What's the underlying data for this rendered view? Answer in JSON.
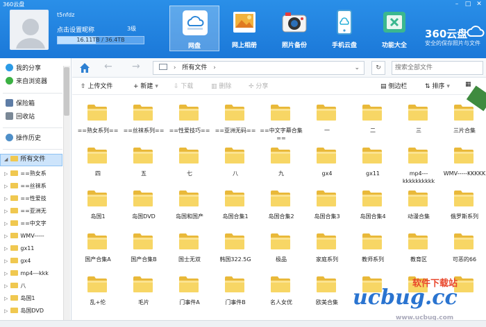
{
  "window": {
    "title": "360云盘"
  },
  "user": {
    "name": "t5nfdz",
    "nick_prompt": "点击设置昵称",
    "level": "3级",
    "quota_text": "16.11TB / 36.4TB",
    "quota_fraction": 0.443
  },
  "nav": [
    {
      "label": "网盘",
      "icon": "cloud-drive-icon"
    },
    {
      "label": "网上相册",
      "icon": "photo-album-icon"
    },
    {
      "label": "照片备份",
      "icon": "camera-icon"
    },
    {
      "label": "手机云盘",
      "icon": "phone-cloud-icon"
    },
    {
      "label": "功能大全",
      "icon": "toolbox-icon"
    }
  ],
  "brand": {
    "name": "360云盘",
    "slogan": "安全的保存照片与文件"
  },
  "sidebar": {
    "links": [
      "我的分享",
      "来自浏览器",
      "保险箱",
      "回收站",
      "操作历史"
    ],
    "root": "所有文件",
    "tree": [
      "==熟女系",
      "==丝袜系",
      "==性爱技",
      "==亚洲无",
      "==中文字",
      "WMV-----",
      "gx11",
      "gx4",
      "mp4---kkk",
      "八",
      "岛国1",
      "岛国DVD"
    ]
  },
  "topbar": {
    "path_root": "所有文件",
    "search_placeholder": "搜索全部文件"
  },
  "toolbar": {
    "upload": "上传文件",
    "new": "新建",
    "download": "下载",
    "delete": "删除",
    "share": "分享",
    "sidebar_toggle": "侧边栏",
    "sort": "排序"
  },
  "files": [
    "==熟女系列==",
    "==丝袜系列==",
    "==性爱技巧==",
    "==亚洲无码==",
    "==中文字幕合集==",
    "一",
    "二",
    "三",
    "三片合集",
    "四",
    "五",
    "七",
    "八",
    "九",
    "gx4",
    "gx11",
    "mp4---kkkkkkkkkk",
    "WMV-----KKKKK",
    "岛国1",
    "岛国DVD",
    "岛国和国产",
    "岛国合集1",
    "岛国合集2",
    "岛国合集3",
    "岛国合集4",
    "动漫合集",
    "俄罗斯系列",
    "国产合集A",
    "国产合集B",
    "国士无双",
    "韩国322.5G",
    "极品",
    "家庭系列",
    "教师系列",
    "教育区",
    "可恶的66",
    "乱+伦",
    "毛片",
    "门事件A",
    "门事件B",
    "名人女优",
    "欧美合集",
    "",
    "",
    ""
  ],
  "watermark": {
    "line1": "软件下载站",
    "line2": "ucbug.cc",
    "line3": "www.ucbug.com"
  }
}
